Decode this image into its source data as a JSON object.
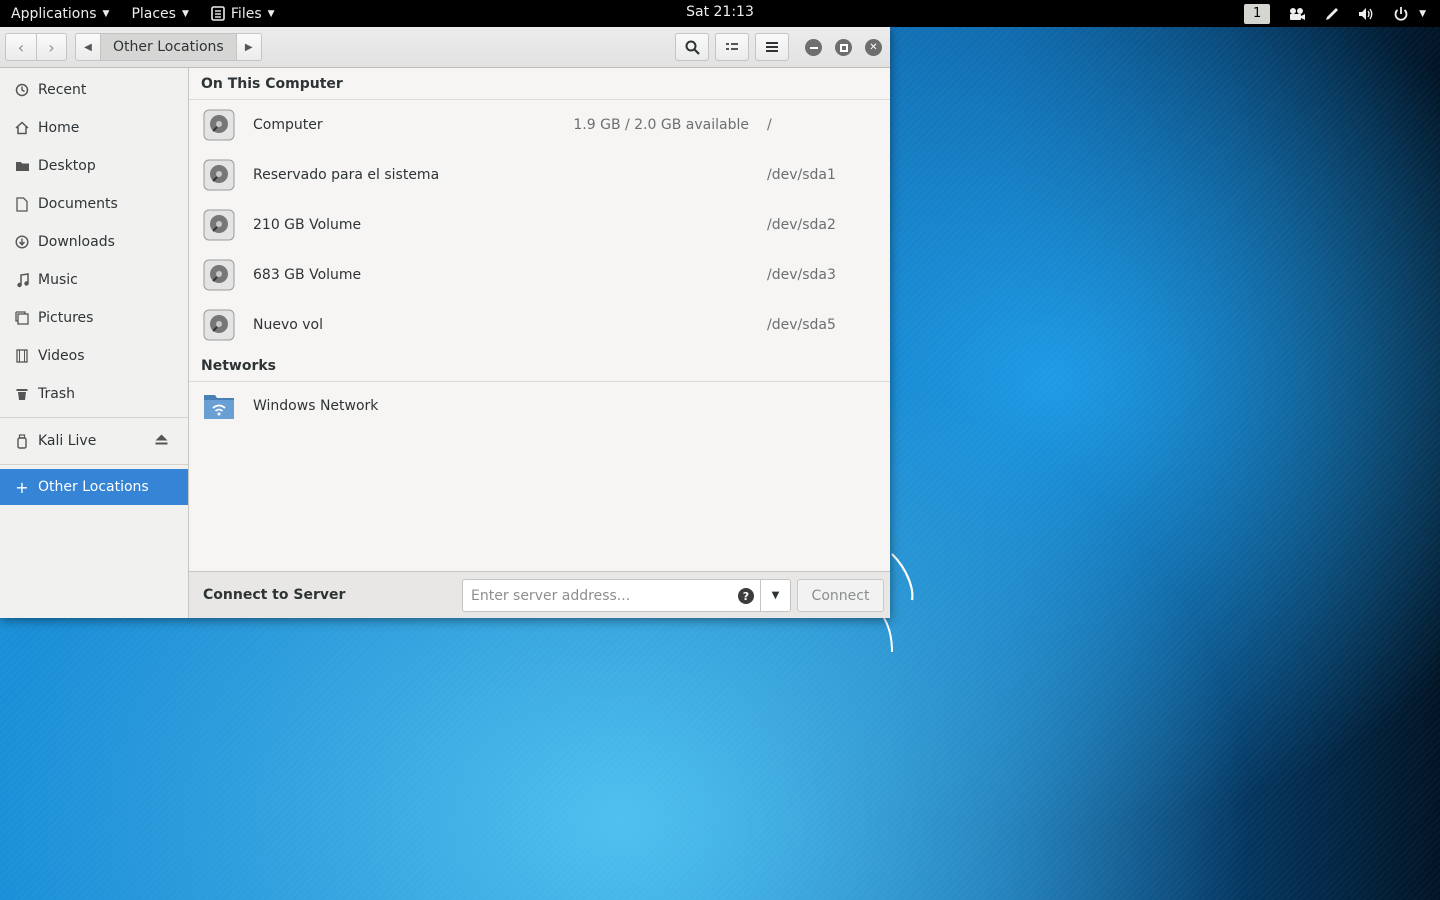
{
  "topbar": {
    "applications": "Applications",
    "places": "Places",
    "files": "Files",
    "clock": "Sat 21:13",
    "workspace": "1"
  },
  "headerbar": {
    "current_location": "Other Locations"
  },
  "sidebar": {
    "items": [
      {
        "label": "Recent",
        "icon": "clock-icon"
      },
      {
        "label": "Home",
        "icon": "home-icon"
      },
      {
        "label": "Desktop",
        "icon": "folder-icon"
      },
      {
        "label": "Documents",
        "icon": "document-icon"
      },
      {
        "label": "Downloads",
        "icon": "download-icon"
      },
      {
        "label": "Music",
        "icon": "music-note-icon"
      },
      {
        "label": "Pictures",
        "icon": "picture-icon"
      },
      {
        "label": "Videos",
        "icon": "film-icon"
      },
      {
        "label": "Trash",
        "icon": "trash-icon"
      }
    ],
    "devices": [
      {
        "label": "Kali Live",
        "icon": "usb-drive-icon"
      }
    ],
    "other_locations": "Other Locations"
  },
  "main": {
    "on_this_computer": "On This Computer",
    "volumes": [
      {
        "name": "Computer",
        "available": "1.9 GB / 2.0 GB available",
        "path": "/"
      },
      {
        "name": "Reservado para el sistema",
        "available": "",
        "path": "/dev/sda1"
      },
      {
        "name": "210 GB Volume",
        "available": "",
        "path": "/dev/sda2"
      },
      {
        "name": "683 GB Volume",
        "available": "",
        "path": "/dev/sda3"
      },
      {
        "name": "Nuevo vol",
        "available": "",
        "path": "/dev/sda5"
      }
    ],
    "networks": "Networks",
    "network_items": [
      {
        "name": "Windows Network"
      }
    ]
  },
  "connect": {
    "label": "Connect to Server",
    "placeholder": "Enter server address...",
    "button": "Connect"
  },
  "colors": {
    "selection": "#3584d6",
    "topbar": "#000000"
  }
}
